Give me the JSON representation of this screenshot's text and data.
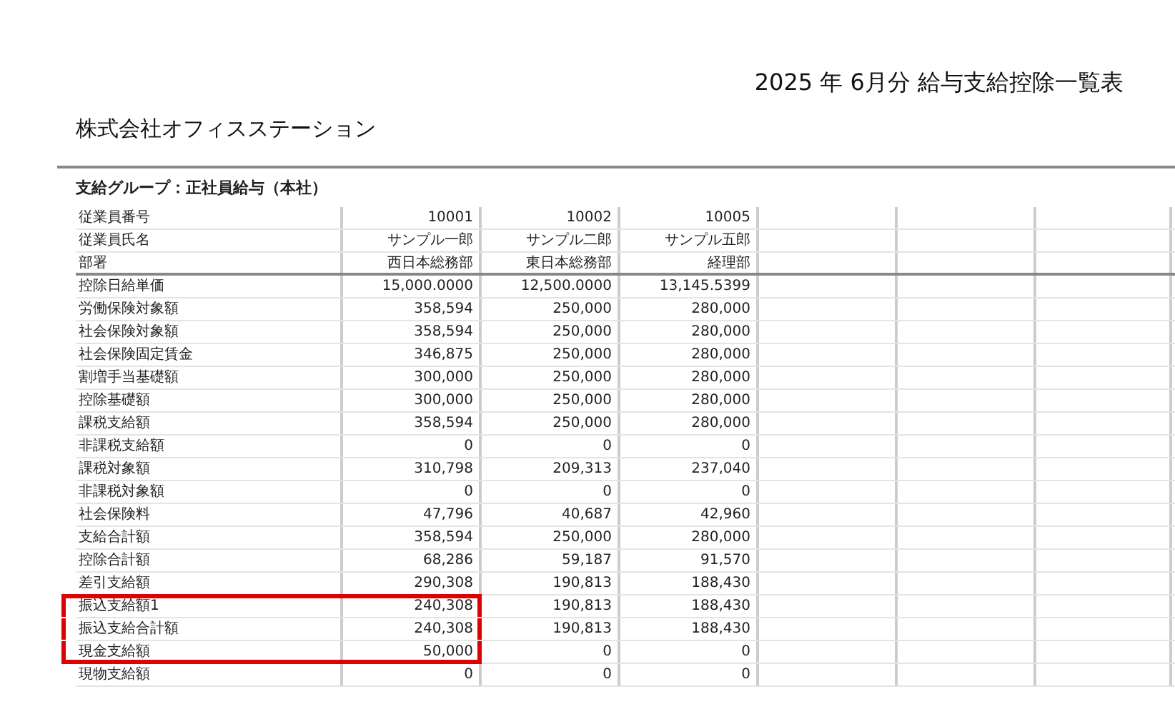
{
  "report_title": "2025 年 6月分 給与支給控除一覧表",
  "company": "株式会社オフィスステーション",
  "group_label": "支給グループ：正社員給与（本社）",
  "header_labels": [
    "従業員番号",
    "従業員氏名",
    "部署"
  ],
  "employees": [
    {
      "number": "10001",
      "name": "サンプル一郎",
      "department": "西日本総務部"
    },
    {
      "number": "10002",
      "name": "サンプル二郎",
      "department": "東日本総務部"
    },
    {
      "number": "10005",
      "name": "サンプル五郎",
      "department": "経理部"
    }
  ],
  "rows": [
    {
      "label": "控除日給単価",
      "values": [
        "15,000.0000",
        "12,500.0000",
        "13,145.5399"
      ],
      "highlighted": false
    },
    {
      "label": "労働保険対象額",
      "values": [
        "358,594",
        "250,000",
        "280,000"
      ],
      "highlighted": false
    },
    {
      "label": "社会保険対象額",
      "values": [
        "358,594",
        "250,000",
        "280,000"
      ],
      "highlighted": false
    },
    {
      "label": "社会保険固定賃金",
      "values": [
        "346,875",
        "250,000",
        "280,000"
      ],
      "highlighted": false
    },
    {
      "label": "割増手当基礎額",
      "values": [
        "300,000",
        "250,000",
        "280,000"
      ],
      "highlighted": false
    },
    {
      "label": "控除基礎額",
      "values": [
        "300,000",
        "250,000",
        "280,000"
      ],
      "highlighted": false
    },
    {
      "label": "課税支給額",
      "values": [
        "358,594",
        "250,000",
        "280,000"
      ],
      "highlighted": false
    },
    {
      "label": "非課税支給額",
      "values": [
        "0",
        "0",
        "0"
      ],
      "highlighted": false
    },
    {
      "label": "課税対象額",
      "values": [
        "310,798",
        "209,313",
        "237,040"
      ],
      "highlighted": false
    },
    {
      "label": "非課税対象額",
      "values": [
        "0",
        "0",
        "0"
      ],
      "highlighted": false
    },
    {
      "label": "社会保険料",
      "values": [
        "47,796",
        "40,687",
        "42,960"
      ],
      "highlighted": false
    },
    {
      "label": "支給合計額",
      "values": [
        "358,594",
        "250,000",
        "280,000"
      ],
      "highlighted": false
    },
    {
      "label": "控除合計額",
      "values": [
        "68,286",
        "59,187",
        "91,570"
      ],
      "highlighted": false
    },
    {
      "label": "差引支給額",
      "values": [
        "290,308",
        "190,813",
        "188,430"
      ],
      "highlighted": false
    },
    {
      "label": "振込支給額1",
      "values": [
        "240,308",
        "190,813",
        "188,430"
      ],
      "highlighted": true
    },
    {
      "label": "振込支給合計額",
      "values": [
        "240,308",
        "190,813",
        "188,430"
      ],
      "highlighted": true
    },
    {
      "label": "現金支給額",
      "values": [
        "50,000",
        "0",
        "0"
      ],
      "highlighted": true
    },
    {
      "label": "現物支給額",
      "values": [
        "0",
        "0",
        "0"
      ],
      "highlighted": false
    }
  ]
}
